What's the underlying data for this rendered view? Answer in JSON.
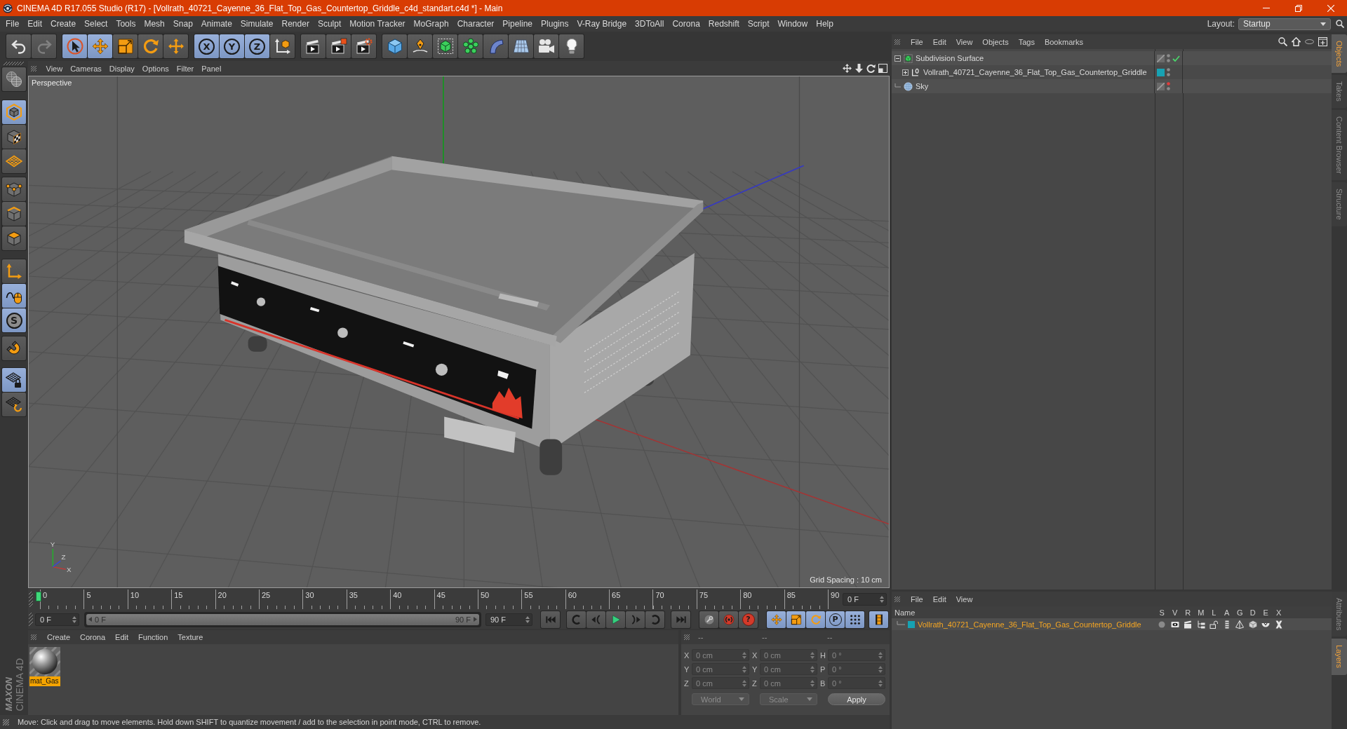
{
  "window": {
    "title": "CINEMA 4D R17.055 Studio (R17) - [Vollrath_40721_Cayenne_36_Flat_Top_Gas_Countertop_Griddle_c4d_standart.c4d *] - Main"
  },
  "menu_bar": [
    "File",
    "Edit",
    "Create",
    "Select",
    "Tools",
    "Mesh",
    "Snap",
    "Animate",
    "Simulate",
    "Render",
    "Sculpt",
    "Motion Tracker",
    "MoGraph",
    "Character",
    "Pipeline",
    "Plugins",
    "V-Ray Bridge",
    "3DToAll",
    "Corona",
    "Redshift",
    "Script",
    "Window",
    "Help"
  ],
  "layout": {
    "label": "Layout:",
    "value": "Startup"
  },
  "toolbar": [
    {
      "tools": [
        {
          "kind": "undo",
          "active": false,
          "disabled": false
        },
        {
          "kind": "redo",
          "active": false,
          "disabled": true
        }
      ]
    },
    {
      "tools": [
        {
          "kind": "select",
          "active": true,
          "disabled": false
        },
        {
          "kind": "move",
          "active": true,
          "disabled": false
        },
        {
          "kind": "scale",
          "active": false,
          "disabled": false
        },
        {
          "kind": "rotate",
          "active": false,
          "disabled": false
        },
        {
          "kind": "transform",
          "active": false,
          "disabled": false
        }
      ]
    },
    {
      "tools": [
        {
          "kind": "axis",
          "label": "X",
          "active": true,
          "disabled": false
        },
        {
          "kind": "axis",
          "label": "Y",
          "active": true,
          "disabled": false
        },
        {
          "kind": "axis",
          "label": "Z",
          "active": true,
          "disabled": false
        },
        {
          "kind": "coordinates",
          "active": false,
          "disabled": false
        }
      ]
    },
    {
      "tools": [
        {
          "kind": "render_view",
          "active": false,
          "disabled": false
        },
        {
          "kind": "render",
          "active": false,
          "disabled": false
        },
        {
          "kind": "render_settings",
          "active": false,
          "disabled": false
        }
      ]
    },
    {
      "tools": [
        {
          "kind": "cube",
          "active": false,
          "disabled": false
        },
        {
          "kind": "pen",
          "active": false,
          "disabled": false
        },
        {
          "kind": "subdivision",
          "active": false,
          "disabled": false
        },
        {
          "kind": "cloner",
          "active": false,
          "disabled": false
        },
        {
          "kind": "bend",
          "active": false,
          "disabled": false
        },
        {
          "kind": "floor",
          "active": false,
          "disabled": false
        },
        {
          "kind": "camera",
          "active": false,
          "disabled": false
        },
        {
          "kind": "light",
          "active": false,
          "disabled": false
        }
      ]
    }
  ],
  "mode_bar": [
    {
      "tools": [
        {
          "kind": "make_editable",
          "active": false
        }
      ]
    },
    {
      "tools": [
        {
          "kind": "model",
          "active": true
        },
        {
          "kind": "texture",
          "active": false
        },
        {
          "kind": "workplane",
          "active": false
        }
      ]
    },
    {
      "tools": [
        {
          "kind": "points",
          "active": false
        },
        {
          "kind": "edges",
          "active": false
        },
        {
          "kind": "polygons",
          "active": false
        }
      ]
    },
    {
      "tools": [
        {
          "kind": "axis_mode",
          "active": false
        },
        {
          "kind": "tweak",
          "active": true
        },
        {
          "kind": "solo",
          "label": "S",
          "active": true
        }
      ]
    },
    {
      "tools": [
        {
          "kind": "snap",
          "active": false
        }
      ]
    },
    {
      "tools": [
        {
          "kind": "workplane_lock",
          "active": true
        },
        {
          "kind": "workplane_rotate",
          "active": false
        }
      ]
    }
  ],
  "viewport": {
    "menu": [
      "View",
      "Cameras",
      "Display",
      "Options",
      "Filter",
      "Panel"
    ],
    "camera": "Perspective",
    "grid_spacing": "Grid Spacing : 10 cm",
    "axis_labels": [
      "Y",
      "Z",
      "X"
    ]
  },
  "objects_panel": {
    "menu": [
      "File",
      "Edit",
      "View",
      "Objects",
      "Tags",
      "Bookmarks"
    ],
    "objects": [
      {
        "name": "Subdivision Surface",
        "kind": "subdivision",
        "expanded": true,
        "hidden_in_editor": false,
        "hidden_in_render": false,
        "enabled": true,
        "children": [
          {
            "name": "Vollrath_40721_Cayenne_36_Flat_Top_Gas_Countertop_Griddle",
            "kind": "null",
            "expanded": false,
            "color": "#17a2b3",
            "hidden_in_editor": false,
            "hidden_in_render": false
          }
        ]
      },
      {
        "name": "Sky",
        "kind": "sky",
        "hidden_in_editor": true,
        "hidden_in_render": false
      }
    ]
  },
  "side_tabs": {
    "top": [
      {
        "label": "Objects",
        "selected": true
      },
      {
        "label": "Takes",
        "selected": false
      },
      {
        "label": "Content Browser",
        "selected": false
      },
      {
        "label": "Structure",
        "selected": false
      }
    ],
    "bottom": [
      {
        "label": "Attributes",
        "selected": false
      },
      {
        "label": "Layers",
        "selected": true
      }
    ]
  },
  "timeline": {
    "frames": [
      "0",
      "5",
      "10",
      "15",
      "20",
      "25",
      "30",
      "35",
      "40",
      "45",
      "50",
      "55",
      "60",
      "65",
      "70",
      "75",
      "80",
      "85",
      "90"
    ],
    "level": 0,
    "current": "0 F"
  },
  "playback": {
    "start": "0 F",
    "range": {
      "start": "0 F",
      "end": "90 F",
      "level": 1
    },
    "end": "90 F",
    "groups": [
      {
        "tools": [
          {
            "kind": "to_start",
            "active": false
          }
        ]
      },
      {
        "tools": [
          {
            "kind": "prev_key",
            "active": false
          },
          {
            "kind": "prev_frame",
            "active": false
          },
          {
            "kind": "play",
            "active": false
          },
          {
            "kind": "next_frame",
            "active": false
          },
          {
            "kind": "next_key",
            "active": false
          }
        ]
      },
      {
        "tools": [
          {
            "kind": "to_end",
            "active": false
          }
        ]
      },
      {
        "tools": [
          {
            "kind": "key_select",
            "active": false
          },
          {
            "kind": "record",
            "active": false
          },
          {
            "kind": "autokey",
            "label": "?",
            "active": false
          }
        ]
      },
      {
        "tools": [
          {
            "kind": "move",
            "active": true
          },
          {
            "kind": "scale",
            "active": true
          },
          {
            "kind": "rotate",
            "active": true
          },
          {
            "kind": "parameter",
            "label": "P",
            "active": true
          },
          {
            "kind": "point_level",
            "active": true
          }
        ]
      },
      {
        "tools": [
          {
            "kind": "timeline",
            "active": true
          }
        ]
      }
    ]
  },
  "materials": {
    "menu": [
      "Create",
      "Corona",
      "Edit",
      "Function",
      "Texture"
    ],
    "items": [
      {
        "name": "mat_Gas",
        "selected": true
      }
    ]
  },
  "coordinates": {
    "headers": [
      "--",
      "--",
      "--"
    ],
    "disabled": true,
    "rows": [
      {
        "fields": [
          {
            "axis": "X",
            "value": "0 cm"
          },
          {
            "axis": "X",
            "value": "0 cm"
          },
          {
            "axis": "H",
            "value": "0 °"
          }
        ]
      },
      {
        "fields": [
          {
            "axis": "Y",
            "value": "0 cm"
          },
          {
            "axis": "Y",
            "value": "0 cm"
          },
          {
            "axis": "P",
            "value": "0 °"
          }
        ]
      },
      {
        "fields": [
          {
            "axis": "Z",
            "value": "0 cm"
          },
          {
            "axis": "Z",
            "value": "0 cm"
          },
          {
            "axis": "B",
            "value": "0 °"
          }
        ]
      }
    ],
    "dropdowns": [
      "World",
      "Scale"
    ],
    "button": "Apply"
  },
  "layers_panel": {
    "menu": [
      "File",
      "Edit",
      "View"
    ],
    "name_header": "Name",
    "columns": [
      "S",
      "V",
      "R",
      "M",
      "L",
      "A",
      "G",
      "D",
      "E",
      "X"
    ],
    "layers": [
      {
        "name": "Vollrath_40721_Cayenne_36_Flat_Top_Gas_Countertop_Griddle",
        "color": "#17a2b3",
        "selected": true
      }
    ]
  },
  "status_bar": {
    "text": "Move: Click and drag to move elements. Hold down SHIFT to quantize movement / add to the selection in point mode, CTRL to remove."
  },
  "logo": {
    "brand": "MAXON",
    "product": "CINEMA 4D"
  }
}
